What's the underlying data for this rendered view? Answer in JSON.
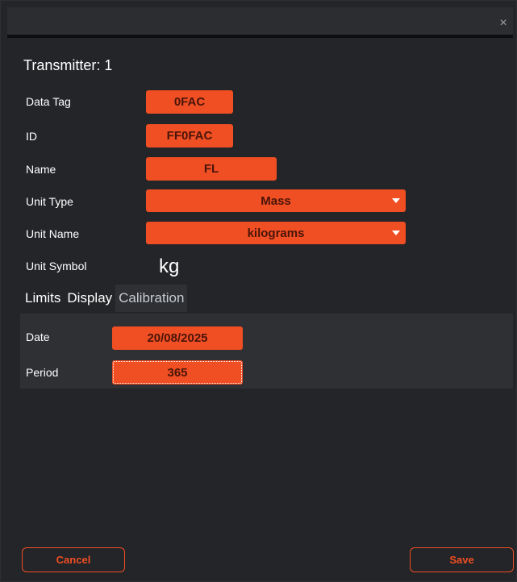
{
  "window": {
    "close_glyph": "×"
  },
  "title": "Transmitter: 1",
  "fields": {
    "data_tag": {
      "label": "Data Tag",
      "value": "0FAC"
    },
    "id": {
      "label": "ID",
      "value": "FF0FAC"
    },
    "name": {
      "label": "Name",
      "value": "FL"
    },
    "unit_type": {
      "label": "Unit Type",
      "value": "Mass"
    },
    "unit_name": {
      "label": "Unit Name",
      "value": "kilograms"
    },
    "unit_symbol": {
      "label": "Unit Symbol",
      "value": "kg"
    }
  },
  "tabs": [
    {
      "label": "Limits",
      "active": false
    },
    {
      "label": "Display",
      "active": false
    },
    {
      "label": "Calibration",
      "active": true
    }
  ],
  "calibration": {
    "date": {
      "label": "Date",
      "value": "20/08/2025"
    },
    "period": {
      "label": "Period",
      "value": "365"
    }
  },
  "footer": {
    "cancel_label": "Cancel",
    "save_label": "Save"
  },
  "colors": {
    "accent": "#f04e23",
    "background": "#232528",
    "panel": "#2e3034"
  }
}
